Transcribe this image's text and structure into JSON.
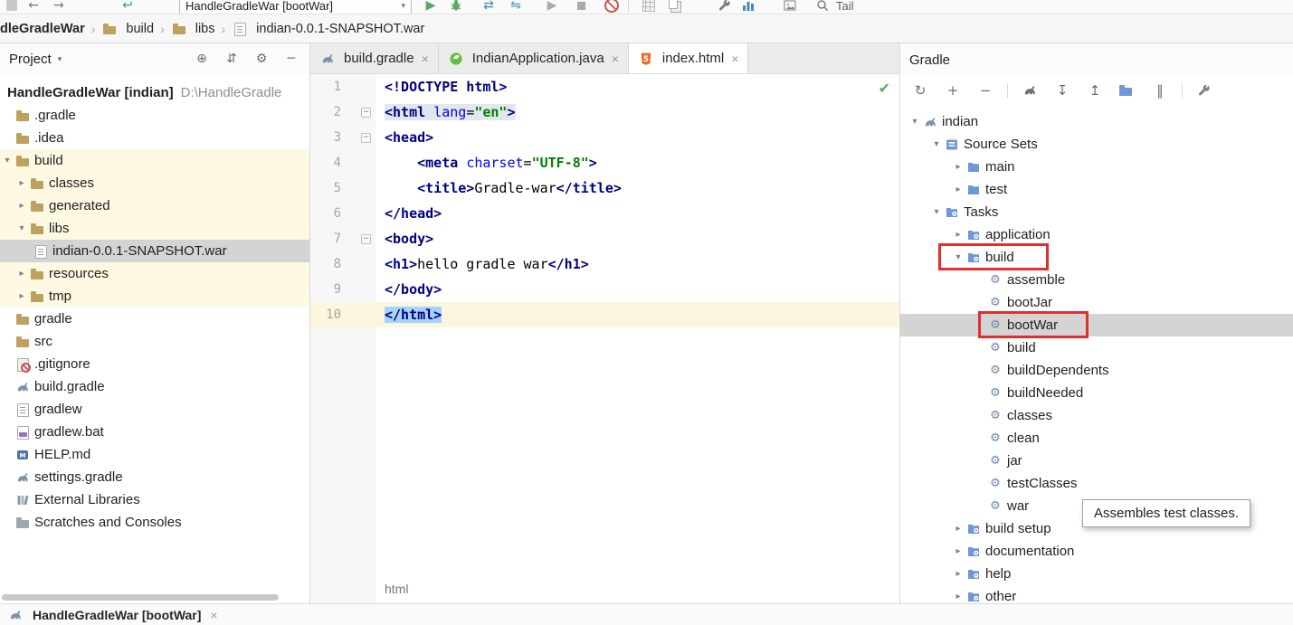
{
  "colors": {
    "tag": "#000080",
    "attr": "#0000FF",
    "str": "#008000",
    "sel": "#A6D2FF",
    "caret_line": "#FCF6DE",
    "match": "#E2E7EE",
    "tree_sel": "#D4D4D4",
    "build_bg": "#FEF9E2",
    "anno": "#E0302C",
    "folder": "#BEA15F",
    "gear": "#7189A5"
  },
  "icons": {
    "gear": "⚙",
    "target": "⊕",
    "collapse": "⇵",
    "minus": "─",
    "check": "✔",
    "close": "×",
    "chev_down": "▾",
    "chev_right": "▸",
    "fold": "−",
    "crumb_sep": "›",
    "select_caret": "▾"
  },
  "toolbar": {
    "items": [
      {
        "kind": "css",
        "css": "appicon",
        "name": "app-icon"
      },
      {
        "kind": "glyph",
        "glyph": "←",
        "color": "#787878",
        "gap": 6,
        "name": "back-icon"
      },
      {
        "kind": "glyph",
        "glyph": "→",
        "color": "#787878",
        "gap": 10,
        "name": "forward-icon"
      },
      {
        "kind": "glyph",
        "glyph": "↩",
        "color": "#2E9E96",
        "gap": 58,
        "name": "recent-locations-icon"
      },
      {
        "kind": "select",
        "label": "HandleGradleWar [bootWar]",
        "gap": 48,
        "name": "run-configuration-select"
      },
      {
        "kind": "glyph",
        "glyph": "▶",
        "color": "#59A869",
        "gap": 12,
        "name": "run-button"
      },
      {
        "kind": "svg",
        "svg": "bug",
        "gap": 10,
        "name": "debug-button"
      },
      {
        "kind": "glyph",
        "glyph": "⇄",
        "color": "#3A8FB7",
        "gap": 18,
        "name": "coverage-button"
      },
      {
        "kind": "glyph",
        "glyph": "⇋",
        "color": "#3A8FB7",
        "gap": 12,
        "name": "profiler-button"
      },
      {
        "kind": "glyph",
        "glyph": "▶",
        "color": "#ABABAB",
        "gap": 22,
        "name": "run-disabled-button"
      },
      {
        "kind": "css",
        "css": "stopicon",
        "gap": 14,
        "name": "stop-button"
      },
      {
        "kind": "css",
        "css": "noentry",
        "gap": 16,
        "name": "kill-process-button"
      },
      {
        "kind": "sep",
        "gap": 9
      },
      {
        "kind": "css",
        "css": "gridicon",
        "gap": 13,
        "name": "grid-icon"
      },
      {
        "kind": "css",
        "css": "copyicon",
        "gap": 10,
        "name": "copy-icon"
      },
      {
        "kind": "svg",
        "svg": "wrench",
        "gap": 38,
        "name": "wrench-icon"
      },
      {
        "kind": "svg",
        "svg": "chart",
        "gap": 8,
        "name": "chart-icon"
      },
      {
        "kind": "svg",
        "svg": "image",
        "gap": 28,
        "name": "image-icon"
      },
      {
        "kind": "svg",
        "svg": "magnifier",
        "gap": 18,
        "name": "search-icon"
      },
      {
        "kind": "label",
        "label": "Tail",
        "gap": 6,
        "name": "tail-label"
      }
    ]
  },
  "navbar": {
    "items": [
      {
        "label": "dleGradleWar",
        "icon": null,
        "bold": true
      },
      {
        "label": "build",
        "icon": "folder"
      },
      {
        "label": "libs",
        "icon": "folder"
      },
      {
        "label": "indian-0.0.1-SNAPSHOT.war",
        "icon": "file"
      }
    ]
  },
  "project": {
    "title": "Project",
    "items": [
      {
        "label": "HandleGradleWar [indian]",
        "suffix": "D:\\HandleGradle",
        "level": 0,
        "icon": null,
        "bold": true
      },
      {
        "label": ".gradle",
        "level": 1,
        "icon": "folder"
      },
      {
        "label": ".idea",
        "level": 1,
        "icon": "folder"
      },
      {
        "label": "build",
        "level": 1,
        "icon": "folder",
        "chevron": "expanded",
        "bg": "build"
      },
      {
        "label": "classes",
        "level": 2,
        "icon": "folder",
        "chevron": "collapsed",
        "bg": "build"
      },
      {
        "label": "generated",
        "level": 2,
        "icon": "folder",
        "chevron": "collapsed",
        "bg": "build"
      },
      {
        "label": "libs",
        "level": 2,
        "icon": "folder",
        "chevron": "expanded",
        "bg": "build"
      },
      {
        "label": "indian-0.0.1-SNAPSHOT.war",
        "level": 3,
        "icon": "archive",
        "bg": "build",
        "selected": true
      },
      {
        "label": "resources",
        "level": 2,
        "icon": "folder",
        "chevron": "collapsed",
        "bg": "build"
      },
      {
        "label": "tmp",
        "level": 2,
        "icon": "folder",
        "chevron": "collapsed",
        "bg": "build"
      },
      {
        "label": "gradle",
        "level": 1,
        "icon": "folder"
      },
      {
        "label": "src",
        "level": 1,
        "icon": "folder"
      },
      {
        "label": ".gitignore",
        "level": 1,
        "icon": "gitignore"
      },
      {
        "label": "build.gradle",
        "level": 1,
        "icon": "gradle"
      },
      {
        "label": "gradlew",
        "level": 1,
        "icon": "script"
      },
      {
        "label": "gradlew.bat",
        "level": 1,
        "icon": "bat"
      },
      {
        "label": "HELP.md",
        "level": 1,
        "icon": "md"
      },
      {
        "label": "settings.gradle",
        "level": 1,
        "icon": "gradle"
      },
      {
        "label": "External Libraries",
        "level": 1,
        "icon": "extlib"
      },
      {
        "label": "Scratches and Consoles",
        "level": 1,
        "icon": "scratch"
      }
    ]
  },
  "editor": {
    "tabs": [
      {
        "label": "build.gradle",
        "icon": "gradle",
        "active": false
      },
      {
        "label": "IndianApplication.java",
        "icon": "spring",
        "active": false
      },
      {
        "label": "index.html",
        "icon": "html",
        "active": true
      }
    ],
    "breadcrumb": "html",
    "lines": [
      {
        "n": 1,
        "tokens": [
          {
            "t": "<!DOCTYPE html>",
            "c": "tag"
          }
        ]
      },
      {
        "n": 2,
        "fold": true,
        "match": true,
        "tokens": [
          {
            "t": "<html",
            "c": "tag"
          },
          {
            "t": " ",
            "c": "plain"
          },
          {
            "t": "lang",
            "c": "attr"
          },
          {
            "t": "=",
            "c": "plain"
          },
          {
            "t": "\"en\"",
            "c": "str"
          },
          {
            "t": ">",
            "c": "tag"
          }
        ]
      },
      {
        "n": 3,
        "fold": true,
        "tokens": [
          {
            "t": "<head>",
            "c": "tag"
          }
        ]
      },
      {
        "n": 4,
        "tokens": [
          {
            "t": "    ",
            "c": "plain"
          },
          {
            "t": "<meta",
            "c": "tag"
          },
          {
            "t": " ",
            "c": "plain"
          },
          {
            "t": "charset",
            "c": "attr"
          },
          {
            "t": "=",
            "c": "plain"
          },
          {
            "t": "\"UTF-8\"",
            "c": "str"
          },
          {
            "t": ">",
            "c": "tag"
          }
        ]
      },
      {
        "n": 5,
        "tokens": [
          {
            "t": "    ",
            "c": "plain"
          },
          {
            "t": "<title>",
            "c": "tag"
          },
          {
            "t": "Gradle-war",
            "c": "plain"
          },
          {
            "t": "</title>",
            "c": "tag"
          }
        ]
      },
      {
        "n": 6,
        "tokens": [
          {
            "t": "</head>",
            "c": "tag"
          }
        ]
      },
      {
        "n": 7,
        "fold": true,
        "tokens": [
          {
            "t": "<body>",
            "c": "tag"
          }
        ]
      },
      {
        "n": 8,
        "tokens": [
          {
            "t": "<h1>",
            "c": "tag"
          },
          {
            "t": "hello gradle war",
            "c": "plain"
          },
          {
            "t": "</h1>",
            "c": "tag"
          }
        ]
      },
      {
        "n": 9,
        "tokens": [
          {
            "t": "</body>",
            "c": "tag"
          }
        ]
      },
      {
        "n": 10,
        "caret": true,
        "tokens": [
          {
            "t": "</html>",
            "c": "tag sel"
          }
        ]
      }
    ]
  },
  "gradle": {
    "title": "Gradle",
    "tooltip": "Assembles test classes.",
    "toolbar": [
      {
        "kind": "glyph",
        "glyph": "↻",
        "name": "refresh-gradle-icon"
      },
      {
        "kind": "glyph",
        "glyph": "+",
        "name": "attach-project-icon"
      },
      {
        "kind": "glyph",
        "glyph": "−",
        "name": "detach-project-icon"
      },
      {
        "kind": "sep"
      },
      {
        "kind": "svg",
        "svg": "elephant",
        "name": "execute-gradle-task-icon"
      },
      {
        "kind": "glyph",
        "glyph": "↧",
        "name": "expand-all-icon"
      },
      {
        "kind": "glyph",
        "glyph": "↥",
        "name": "collapse-all-icon"
      },
      {
        "kind": "css",
        "css": "bluefolder",
        "name": "group-tasks-icon"
      },
      {
        "kind": "glyph",
        "glyph": "‖",
        "name": "show-task-executions-icon"
      },
      {
        "kind": "sep"
      },
      {
        "kind": "svg",
        "svg": "wrench",
        "name": "gradle-settings-icon"
      }
    ],
    "items": [
      {
        "label": "indian",
        "level": 0,
        "icon": "elephant",
        "chevron": "expanded"
      },
      {
        "label": "Source Sets",
        "level": 1,
        "icon": "sets",
        "chevron": "expanded"
      },
      {
        "label": "main",
        "level": 2,
        "icon": "module",
        "chevron": "collapsed"
      },
      {
        "label": "test",
        "level": 2,
        "icon": "module",
        "chevron": "collapsed"
      },
      {
        "label": "Tasks",
        "level": 1,
        "icon": "taskgroup",
        "chevron": "expanded"
      },
      {
        "label": "application",
        "level": 2,
        "icon": "taskgroup",
        "chevron": "collapsed"
      },
      {
        "label": "build",
        "level": 2,
        "icon": "taskgroup",
        "chevron": "expanded"
      },
      {
        "label": "assemble",
        "level": 3,
        "icon": "task"
      },
      {
        "label": "bootJar",
        "level": 3,
        "icon": "task"
      },
      {
        "label": "bootWar",
        "level": 3,
        "icon": "task",
        "selected": true
      },
      {
        "label": "build",
        "level": 3,
        "icon": "task"
      },
      {
        "label": "buildDependents",
        "level": 3,
        "icon": "task"
      },
      {
        "label": "buildNeeded",
        "level": 3,
        "icon": "task"
      },
      {
        "label": "classes",
        "level": 3,
        "icon": "task"
      },
      {
        "label": "clean",
        "level": 3,
        "icon": "task"
      },
      {
        "label": "jar",
        "level": 3,
        "icon": "task"
      },
      {
        "label": "testClasses",
        "level": 3,
        "icon": "task"
      },
      {
        "label": "war",
        "level": 3,
        "icon": "task"
      },
      {
        "label": "build setup",
        "level": 2,
        "icon": "taskgroup",
        "chevron": "collapsed"
      },
      {
        "label": "documentation",
        "level": 2,
        "icon": "taskgroup",
        "chevron": "collapsed"
      },
      {
        "label": "help",
        "level": 2,
        "icon": "taskgroup",
        "chevron": "collapsed"
      },
      {
        "label": "other",
        "level": 2,
        "icon": "taskgroup",
        "chevron": "collapsed"
      }
    ]
  },
  "bottom": {
    "run_tab": "HandleGradleWar [bootWar]"
  }
}
